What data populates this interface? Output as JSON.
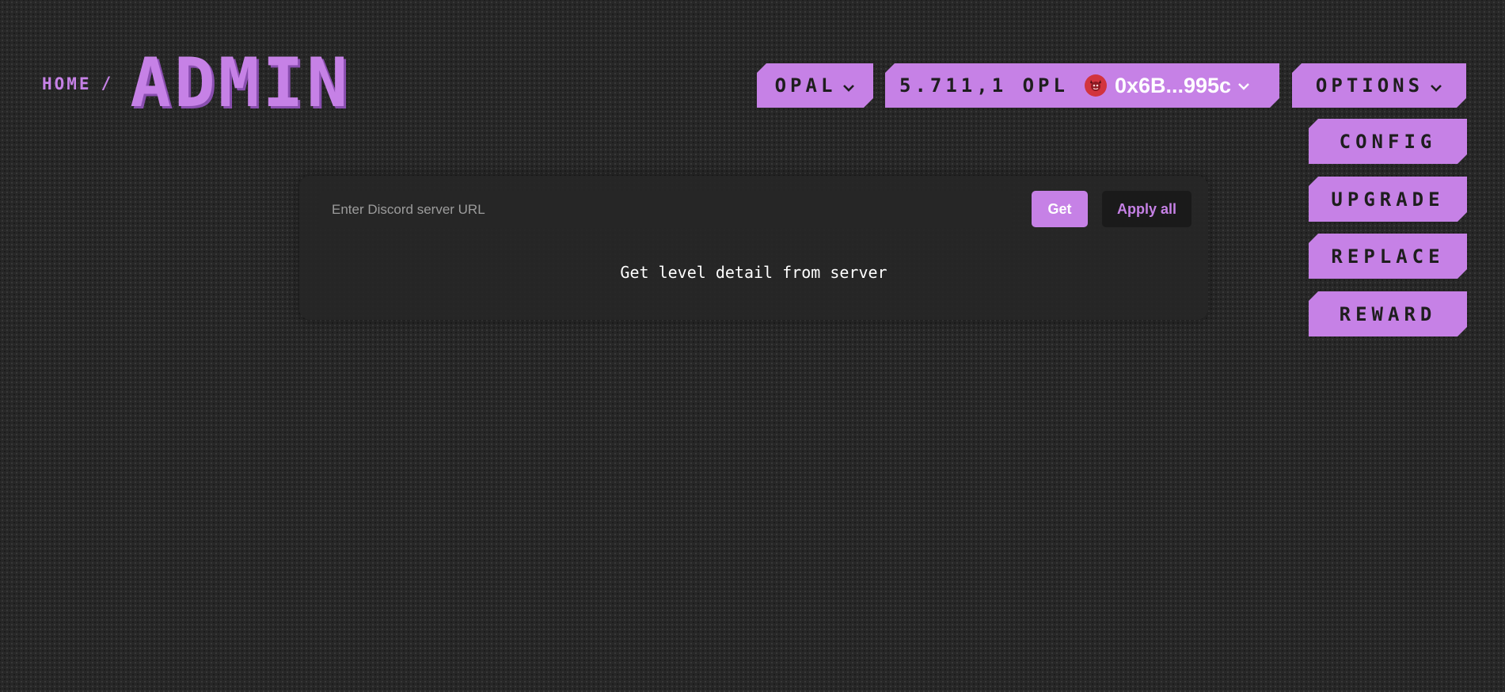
{
  "breadcrumb": {
    "home": "HOME",
    "separator": "/",
    "title": "ADMIN"
  },
  "header": {
    "network_label": "OPAL",
    "wallet": {
      "balance": "5.711,1 OPL",
      "address": "0x6B...995c",
      "avatar_icon": "devil-avatar-icon"
    },
    "options_label": "OPTIONS"
  },
  "menu": {
    "items": [
      {
        "label": "CONFIG"
      },
      {
        "label": "UPGRADE"
      },
      {
        "label": "REPLACE"
      },
      {
        "label": "REWARD"
      }
    ]
  },
  "card": {
    "input_placeholder": "Enter Discord server URL",
    "input_value": "",
    "get_label": "Get",
    "apply_label": "Apply all",
    "message": "Get level detail from server"
  },
  "colors": {
    "accent": "#c681e6",
    "background": "#272727",
    "card": "#262626",
    "avatar": "#d2343e"
  }
}
